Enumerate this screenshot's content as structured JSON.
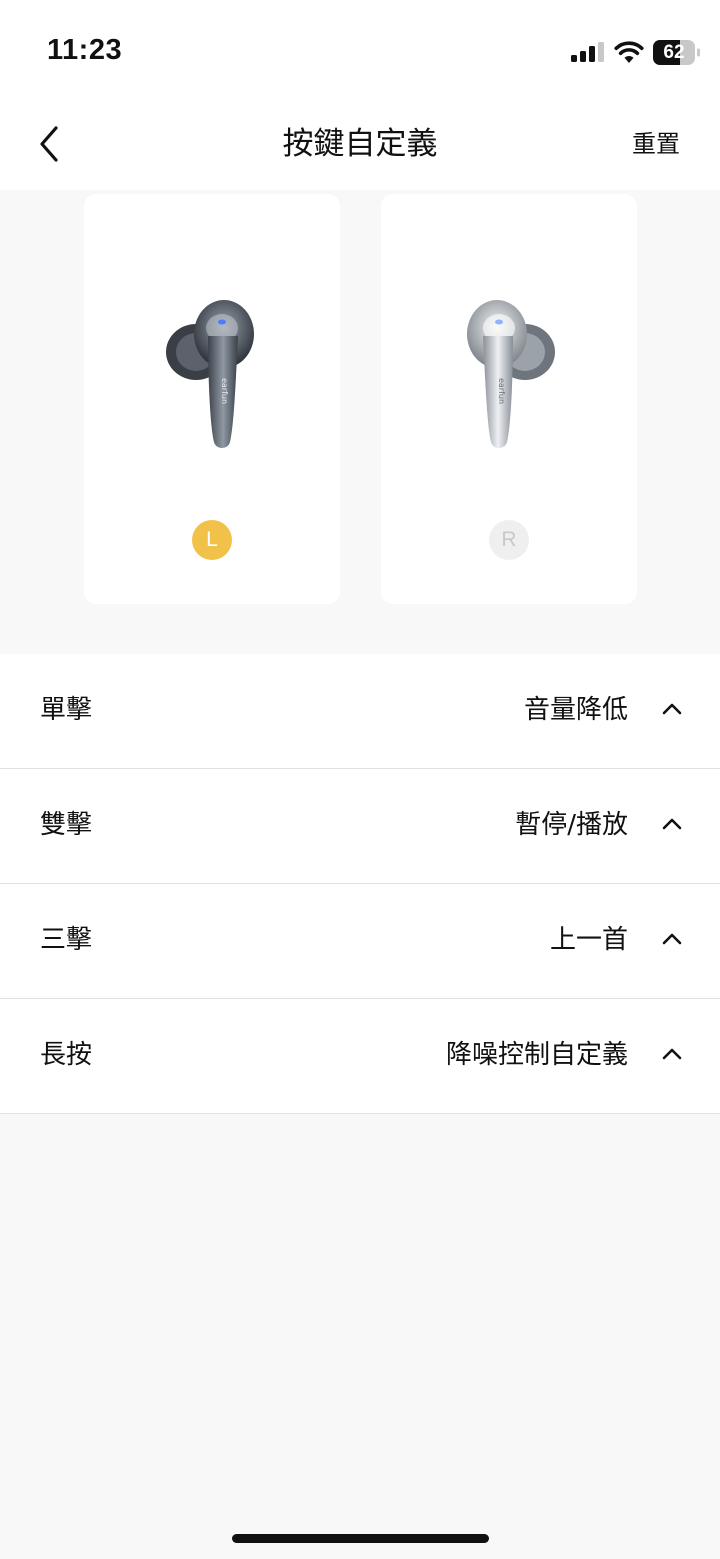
{
  "status_bar": {
    "time": "11:23",
    "battery_level": "62",
    "icons": [
      "signal-icon",
      "wifi-icon",
      "battery-icon"
    ]
  },
  "header": {
    "title": "按鍵自定義",
    "reset_label": "重置",
    "back_icon": "chevron-left-icon"
  },
  "earbuds": {
    "left": {
      "badge": "L",
      "selected": true
    },
    "right": {
      "badge": "R",
      "selected": false
    }
  },
  "controls": [
    {
      "action": "單擊",
      "value": "音量降低",
      "icon": "chevron-up-icon"
    },
    {
      "action": "雙擊",
      "value": "暫停/播放",
      "icon": "chevron-up-icon"
    },
    {
      "action": "三擊",
      "value": "上一首",
      "icon": "chevron-up-icon"
    },
    {
      "action": "長按",
      "value": "降噪控制自定義",
      "icon": "chevron-up-icon"
    }
  ],
  "colors": {
    "accent": "#f2c14a",
    "background": "#f8f8f8",
    "card": "#ffffff",
    "divider": "#e1e1e1"
  }
}
